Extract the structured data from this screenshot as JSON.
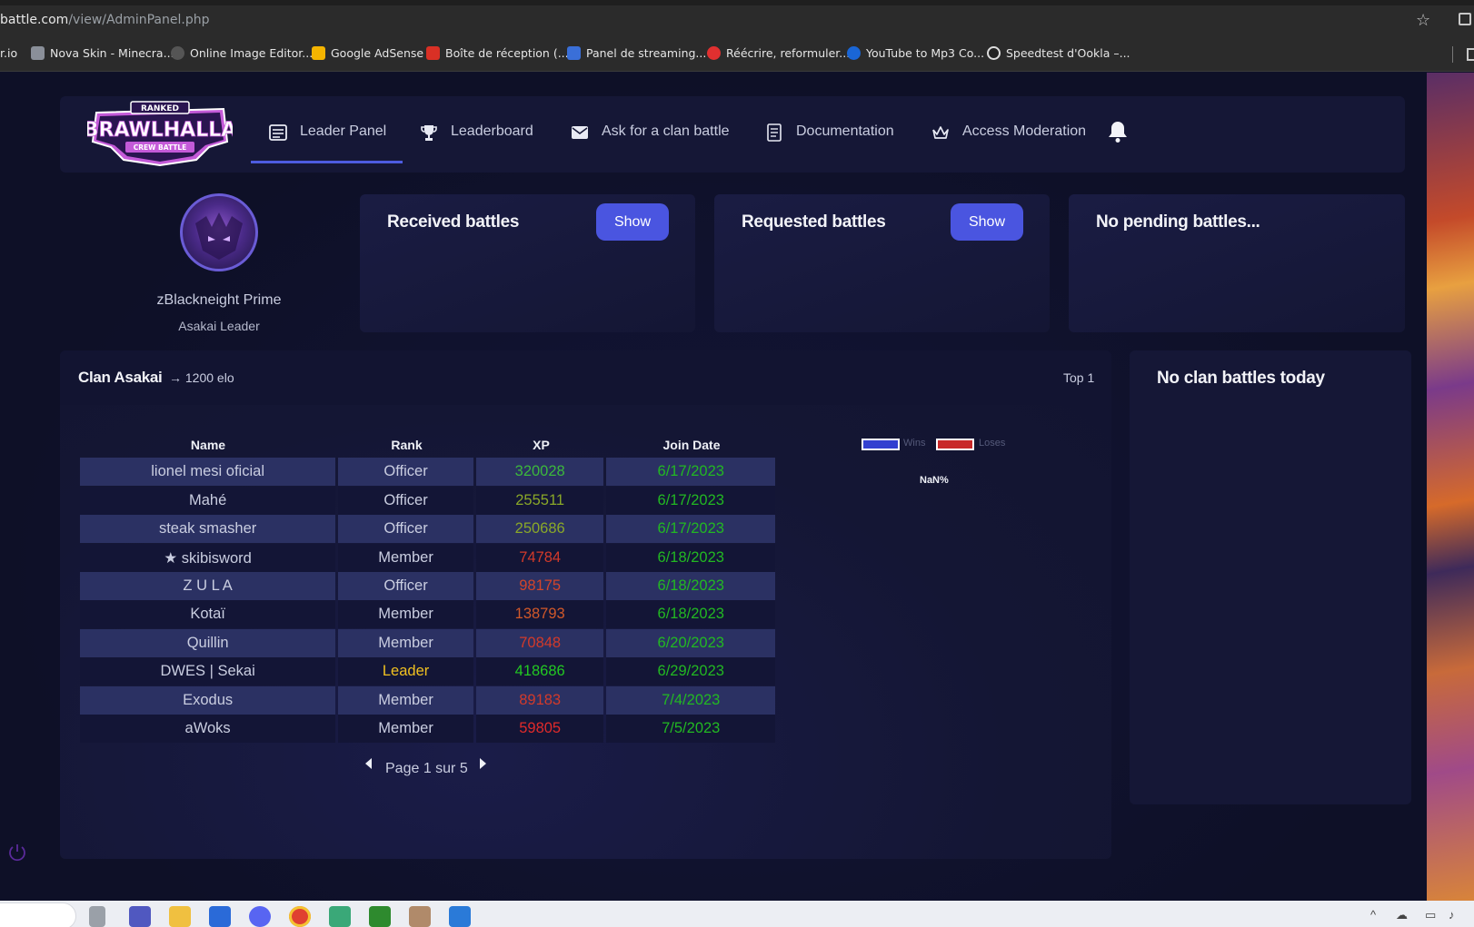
{
  "browser": {
    "url_host": "battle.com",
    "url_path": "/view/AdminPanel.php",
    "bookmarks": [
      {
        "label": "r.io",
        "color": ""
      },
      {
        "label": "Nova Skin - Minecra...",
        "color": "#8a8f99"
      },
      {
        "label": "Online Image Editor...",
        "color": "#6d6d6d"
      },
      {
        "label": "Google AdSense",
        "color": "#f4b400"
      },
      {
        "label": "Boîte de réception (...",
        "color": "#d93025"
      },
      {
        "label": "Panel de streaming...",
        "color": "#3a6fd8"
      },
      {
        "label": "Réécrire, reformuler...",
        "color": "#e03030"
      },
      {
        "label": "YouTube to Mp3 Co...",
        "color": "#1a66d6"
      },
      {
        "label": "Speedtest d'Ookla –...",
        "color": "#222222"
      }
    ]
  },
  "logo": {
    "top": "RANKED",
    "main": "BRAWLHALLA",
    "sub": "CREW BATTLE"
  },
  "nav": {
    "items": [
      {
        "label": "Leader Panel",
        "icon": "panel-icon",
        "active": true
      },
      {
        "label": "Leaderboard",
        "icon": "trophy-icon"
      },
      {
        "label": "Ask for a clan battle",
        "icon": "envelope-icon"
      },
      {
        "label": "Documentation",
        "icon": "document-icon"
      },
      {
        "label": "Access Moderation",
        "icon": "crown-icon"
      }
    ],
    "bell_icon": "bell-icon"
  },
  "profile": {
    "name": "zBlackneight Prime",
    "role": "Asakai Leader"
  },
  "cards": {
    "received": {
      "title": "Received battles",
      "button": "Show"
    },
    "requested": {
      "title": "Requested battles",
      "button": "Show"
    },
    "pending": {
      "title": "No pending battles..."
    }
  },
  "clan": {
    "name": "Clan Asakai",
    "elo": "→ 1200 elo",
    "top": "Top 1",
    "columns": [
      "Name",
      "Rank",
      "XP",
      "Join Date"
    ],
    "rows": [
      {
        "name": "lionel mesi oficial",
        "rank": "Officer",
        "xp": "320028",
        "xp_color": "#3cb83c",
        "date": "6/17/2023"
      },
      {
        "name": "Mahé",
        "rank": "Officer",
        "xp": "255511",
        "xp_color": "#8aa828",
        "date": "6/17/2023"
      },
      {
        "name": "steak smasher",
        "rank": "Officer",
        "xp": "250686",
        "xp_color": "#8aa828",
        "date": "6/17/2023"
      },
      {
        "name": "★ skibisword",
        "rank": "Member",
        "xp": "74784",
        "xp_color": "#d23a2a",
        "date": "6/18/2023"
      },
      {
        "name": "Z U L A",
        "rank": "Officer",
        "xp": "98175",
        "xp_color": "#d2452a",
        "date": "6/18/2023"
      },
      {
        "name": "Kotaï",
        "rank": "Member",
        "xp": "138793",
        "xp_color": "#d0582a",
        "date": "6/18/2023"
      },
      {
        "name": "Quillin",
        "rank": "Member",
        "xp": "70848",
        "xp_color": "#d23a2a",
        "date": "6/20/2023"
      },
      {
        "name": "DWES | Sekai",
        "rank": "Leader",
        "rank_color": "#f0c020",
        "xp": "418686",
        "xp_color": "#22c822",
        "date": "6/29/2023"
      },
      {
        "name": "Exodus",
        "rank": "Member",
        "xp": "89183",
        "xp_color": "#d23a2a",
        "date": "7/4/2023"
      },
      {
        "name": "aWoks",
        "rank": "Member",
        "xp": "59805",
        "xp_color": "#e02a2a",
        "date": "7/5/2023"
      }
    ],
    "pager": "Page 1 sur 5",
    "legend": {
      "wins": "Wins",
      "loses": "Loses",
      "wins_color": "#3340d0",
      "loses_color": "#c82828"
    },
    "ratio": "NaN%"
  },
  "side": {
    "title": "No clan battles today"
  },
  "colors": {
    "accent": "#4a55e0",
    "date_green": "#22b822"
  }
}
